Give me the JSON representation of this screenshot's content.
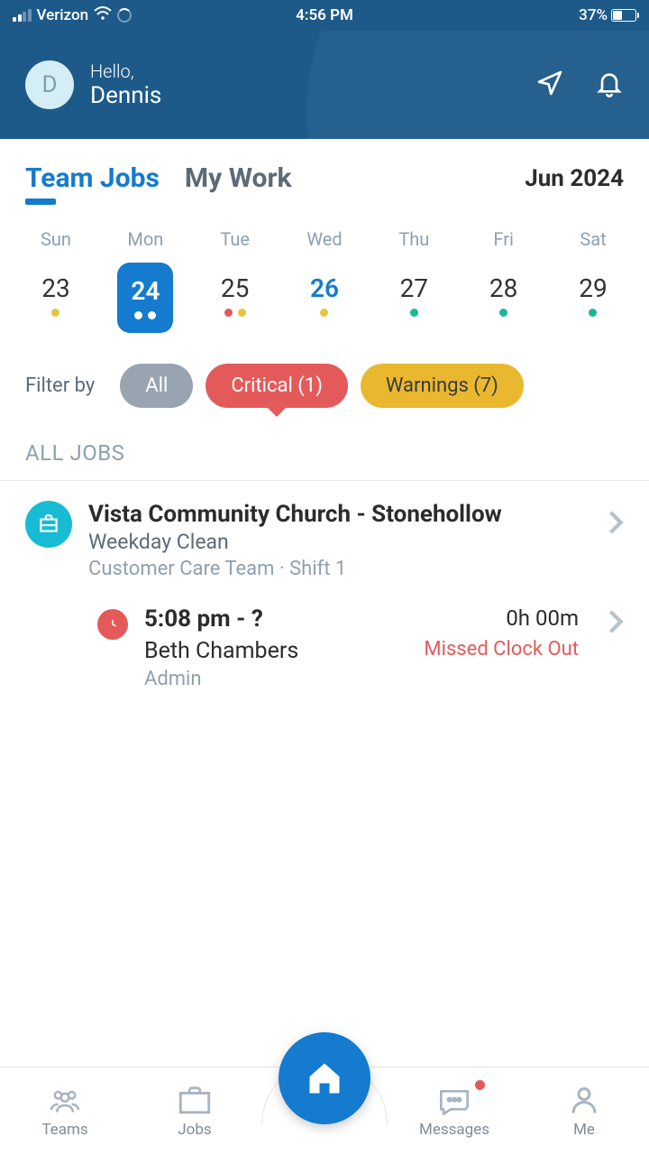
{
  "status": {
    "carrier": "Verizon",
    "time": "4:56 PM",
    "battery": "37%"
  },
  "header": {
    "hello": "Hello,",
    "name": "Dennis",
    "avatar_initial": "D"
  },
  "tabs": {
    "team": "Team Jobs",
    "mywork": "My Work",
    "month": "Jun 2024"
  },
  "calendar": [
    {
      "dow": "Sun",
      "num": "23",
      "dots": [
        "y"
      ]
    },
    {
      "dow": "Mon",
      "num": "24",
      "dots": [
        "w",
        "w"
      ],
      "selected": true
    },
    {
      "dow": "Tue",
      "num": "25",
      "dots": [
        "r",
        "y"
      ]
    },
    {
      "dow": "Wed",
      "num": "26",
      "dots": [
        "y"
      ],
      "highlight": true
    },
    {
      "dow": "Thu",
      "num": "27",
      "dots": [
        "g"
      ]
    },
    {
      "dow": "Fri",
      "num": "28",
      "dots": [
        "g"
      ]
    },
    {
      "dow": "Sat",
      "num": "29",
      "dots": [
        "g"
      ]
    }
  ],
  "filter": {
    "label": "Filter by",
    "all": "All",
    "critical": "Critical (1)",
    "warnings": "Warnings (7)"
  },
  "section": {
    "all_jobs": "ALL JOBS"
  },
  "job": {
    "title": "Vista Community Church - Stonehollow",
    "subtitle": "Weekday Clean",
    "meta": "Customer Care Team · Shift 1"
  },
  "shift": {
    "time": "5:08 pm - ?",
    "person": "Beth Chambers",
    "role": "Admin",
    "duration": "0h 00m",
    "alert": "Missed Clock Out"
  },
  "nav": {
    "teams": "Teams",
    "jobs": "Jobs",
    "messages": "Messages",
    "me": "Me"
  }
}
